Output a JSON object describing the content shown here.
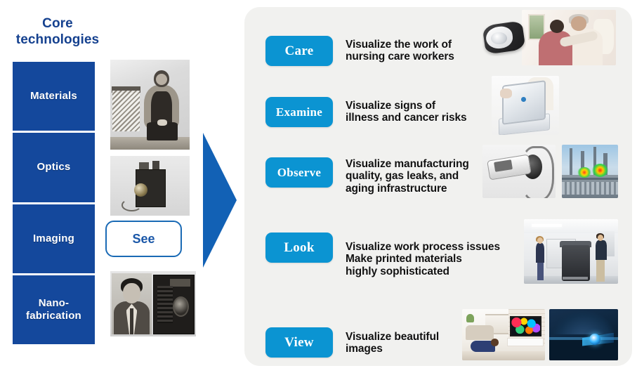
{
  "left": {
    "title": "Core\ntechnologies",
    "title_color": "#15418f",
    "block_color": "#14489c",
    "tech_blocks": [
      {
        "label": "Materials"
      },
      {
        "label": "Optics"
      },
      {
        "label": "Imaging"
      },
      {
        "label": "Nano-\nfabrication"
      }
    ],
    "see_button": {
      "label": "See",
      "border_color": "#1a6ab5",
      "text_color": "#1a57a8"
    },
    "photos": [
      {
        "name": "historic-seated-portrait-photo"
      },
      {
        "name": "vintage-box-camera-photo"
      },
      {
        "name": "founder-portrait-and-folding-camera-photo"
      }
    ]
  },
  "arrow": {
    "name": "right-pointing-arrow",
    "color": "#1261b5"
  },
  "panel": {
    "background": "#f1f1ef",
    "pill_color": "#0b94d2",
    "pill_text_color": "#ffffff",
    "rows": [
      {
        "pill": "Care",
        "text": "Visualize the work of\nnursing care workers",
        "images": [
          "care-sensor-device",
          "caregiver-hugging-elderly-person-photo"
        ]
      },
      {
        "pill": "Examine",
        "text": "Visualize signs of\nillness and cancer risks",
        "images": [
          "portable-digital-radiography-panel-photo"
        ]
      },
      {
        "pill": "Observe",
        "text": "Visualize manufacturing\nquality, gas leaks, and\naging infrastructure",
        "images": [
          "industrial-inspection-camera-photo",
          "chemical-plant-gas-leak-thermal-overlay-photo"
        ]
      },
      {
        "pill": "Look",
        "text": "Visualize work process issues\nMake printed materials\nhighly sophisticated",
        "images": [
          "office-multifunction-printer-scene-photo"
        ]
      },
      {
        "pill": "View",
        "text": "Visualize beautiful\nimages",
        "images": [
          "living-room-tv-viewing-photo",
          "blue-stage-projection-photo"
        ]
      }
    ]
  }
}
